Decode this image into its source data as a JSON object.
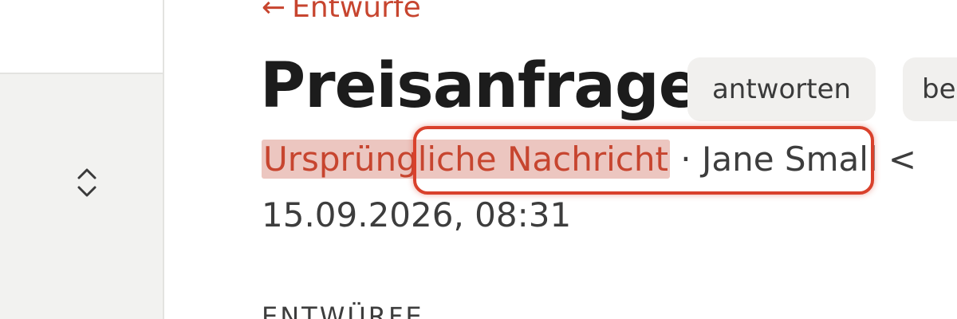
{
  "colors": {
    "accent": "#c7452f",
    "highlight_ring": "#d9412c",
    "sidebar_bg": "#f2f2f0",
    "button_bg": "#f1f0ee",
    "title_text": "#1c1c1c"
  },
  "nav": {
    "back_arrow": "←",
    "back_label": "Entwürfe"
  },
  "message": {
    "title": "Preisanfrage",
    "original_link": "Ursprüngliche Nachricht",
    "separator": " · ",
    "sender": "Jane Small <",
    "date": "15.09.2026, 08:31"
  },
  "actions": {
    "reply_label": "antworten",
    "edit_label": "be"
  },
  "section": {
    "heading": "ENTWÜRFE"
  },
  "icons": {
    "sort_toggle": "chevron-up-down-icon"
  }
}
